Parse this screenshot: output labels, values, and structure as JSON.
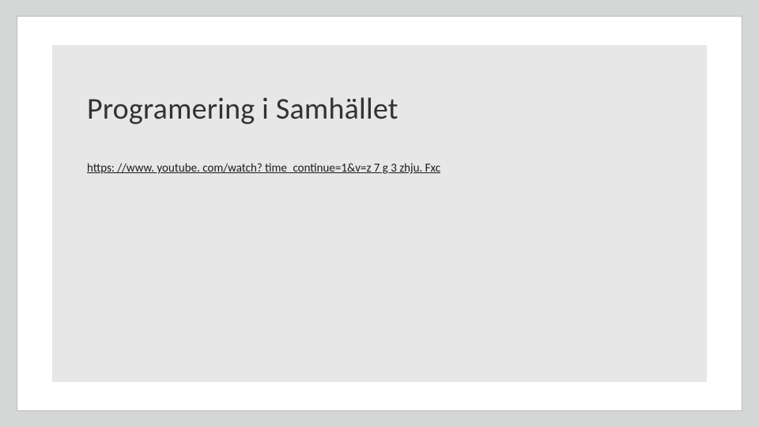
{
  "slide": {
    "title": "Programering i Samhället",
    "link_text": "https: //www. youtube. com/watch? time_continue=1&v=z 7 g 3 zhju. Fxc"
  }
}
